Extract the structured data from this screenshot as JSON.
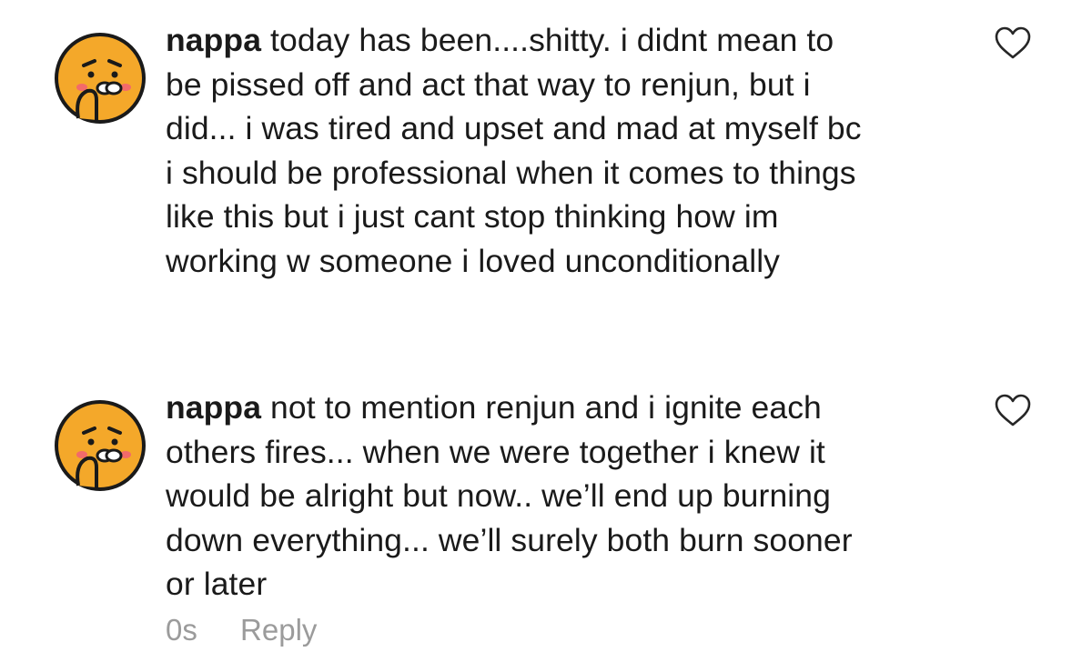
{
  "comments": [
    {
      "username": "nappa",
      "lines": [
        "today has been....shitty. i didnt mean to",
        "be pissed off and act that way to renjun, but i",
        "did... i was tired and upset and mad at myself bc",
        "i should be professional when it comes to things",
        "like this but i just cant stop thinking how im",
        "working w someone i loved unconditionally"
      ],
      "avatar_icon": "kakao-ryan-avatar-icon",
      "like_icon": "heart-outline-icon"
    },
    {
      "username": "nappa",
      "lines": [
        "not to mention renjun and i ignite each",
        "others fires... when we were together i knew it",
        "would be alright but now.. we’ll end up burning",
        "down everything... we’ll surely both burn sooner",
        "or later"
      ],
      "time": "0s",
      "reply_label": "Reply",
      "avatar_icon": "kakao-ryan-avatar-icon",
      "like_icon": "heart-outline-icon"
    }
  ],
  "colors": {
    "text": "#1a1a1a",
    "meta": "#9b9b9b",
    "avatar_face": "#F4A82A",
    "avatar_outline": "#1a1a1a",
    "avatar_blush": "#F36A6A",
    "heart_stroke": "#262626"
  }
}
